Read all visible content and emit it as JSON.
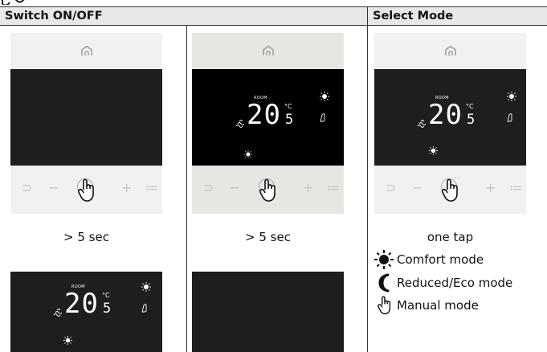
{
  "headers": {
    "switch": "Switch ON/OFF",
    "select": "Select Mode"
  },
  "captions": {
    "col1": "> 5 sec",
    "col2": "> 5 sec",
    "col3": "one tap"
  },
  "display": {
    "room": "ROOM",
    "temp": "20",
    "unit": "°C",
    "decimal": "5"
  },
  "legend": [
    {
      "icon": "sun-icon",
      "label": "Comfort mode"
    },
    {
      "icon": "moon-icon",
      "label": "Reduced/Eco mode"
    },
    {
      "icon": "hand-icon",
      "label": "Manual mode"
    }
  ],
  "buttons": {
    "back": "⊃",
    "minus": "−",
    "plus": "+",
    "menu": "≔"
  }
}
